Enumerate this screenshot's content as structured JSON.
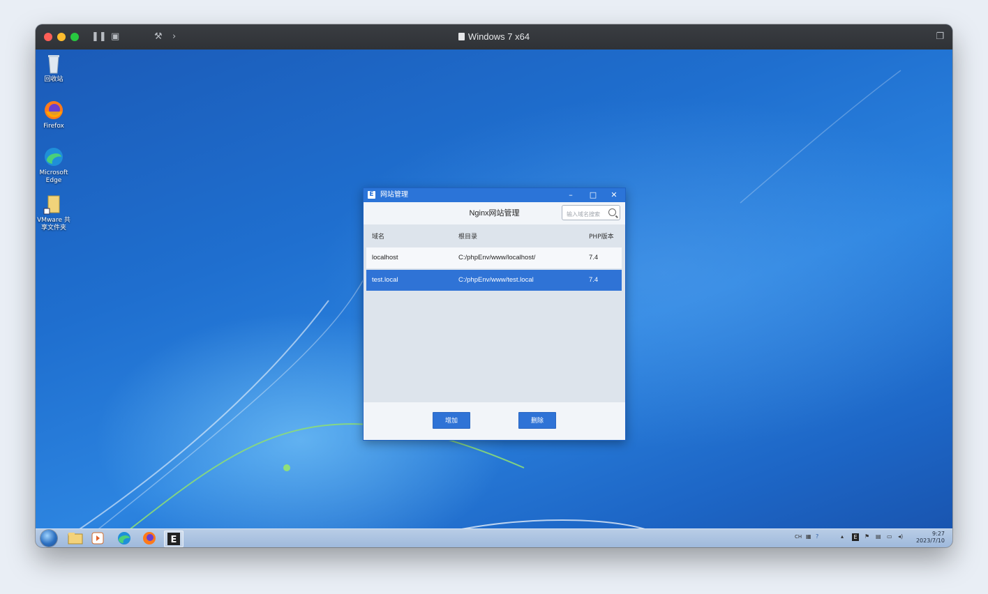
{
  "vm": {
    "title": "Windows 7 x64"
  },
  "desktop_icons": [
    {
      "label": "回收站"
    },
    {
      "label": "Firefox"
    },
    {
      "label": "Microsoft Edge"
    },
    {
      "label": "VMware 共享文件夹"
    }
  ],
  "app": {
    "window_title": "网站管理",
    "logo_letter": "E",
    "heading": "Nginx网站管理",
    "search_placeholder": "输入域名搜索",
    "columns": [
      "域名",
      "根目录",
      "PHP版本"
    ],
    "rows": [
      {
        "domain": "localhost",
        "root": "C:/phpEnv/www/localhost/",
        "php": "7.4",
        "selected": false
      },
      {
        "domain": "test.local",
        "root": "C:/phpEnv/www/test.local",
        "php": "7.4",
        "selected": true
      }
    ],
    "add_label": "增加",
    "delete_label": "删除",
    "accent": "#2f73d6"
  },
  "taskbar": {
    "pinned": [
      "start-orb",
      "explorer",
      "media-player",
      "edge",
      "firefox",
      "e-app"
    ],
    "tray_ime": "CH",
    "time": "9:27",
    "date": "2023/7/10"
  }
}
